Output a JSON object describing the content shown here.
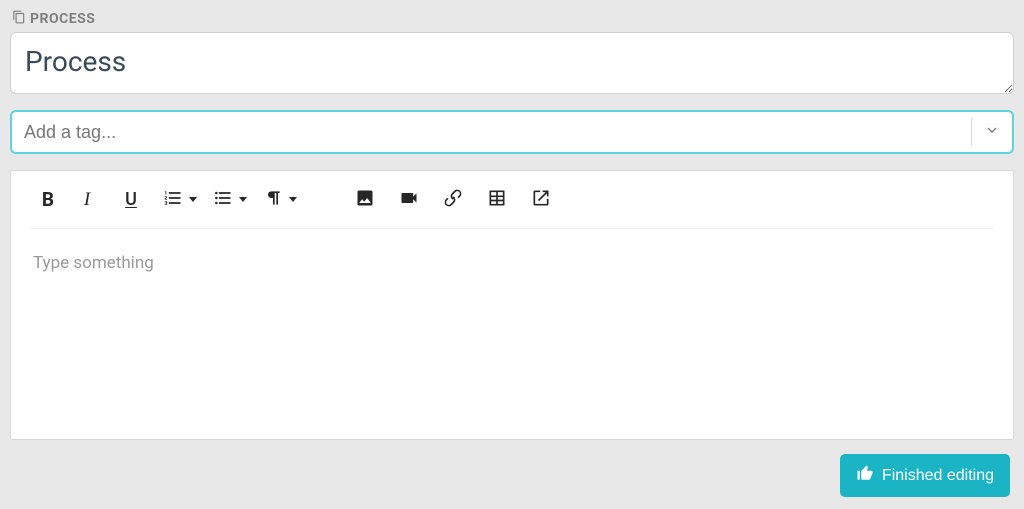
{
  "header": {
    "label": "PROCESS"
  },
  "title": {
    "value": "Process"
  },
  "tags": {
    "placeholder": "Add a tag..."
  },
  "editor": {
    "placeholder": "Type something",
    "toolbar": {
      "bold": "B",
      "italic": "I",
      "underline": "U"
    },
    "icons": {
      "ordered_list": "ordered-list-icon",
      "unordered_list": "unordered-list-icon",
      "paragraph": "paragraph-icon",
      "image": "image-icon",
      "video": "video-icon",
      "link": "link-icon",
      "table": "table-icon",
      "external_link": "external-link-icon"
    }
  },
  "footer": {
    "finish_label": "Finished editing"
  },
  "colors": {
    "accent": "#1bb4c4",
    "focus_ring": "#5ed3df"
  }
}
